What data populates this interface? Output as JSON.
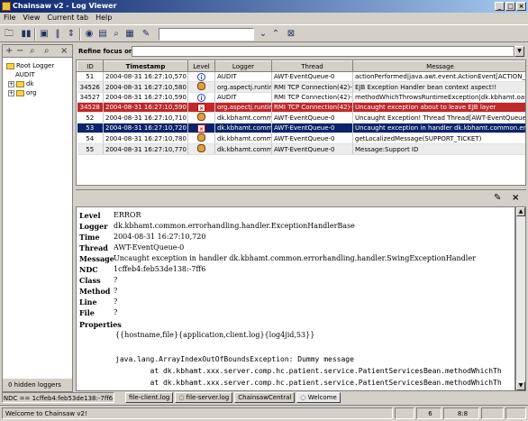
{
  "window": {
    "title": "Chainsaw v2 - Log Viewer"
  },
  "menu": [
    "File",
    "View",
    "Current tab",
    "Help"
  ],
  "left": {
    "tree": [
      {
        "label": "Root Logger"
      },
      {
        "label": "AUDIT"
      },
      {
        "label": "dk"
      },
      {
        "label": "org"
      }
    ],
    "hidden_loggers": "0 hidden loggers"
  },
  "refine": {
    "label": "Refine focus on:"
  },
  "table": {
    "columns": [
      "ID",
      "Timestamp",
      "Level",
      "Logger",
      "Thread",
      "Message"
    ],
    "rows": [
      {
        "id": "51",
        "ts": "2004-08-31 16:27:10,570",
        "level": "info",
        "logger": "AUDIT",
        "thread": "AWT-EventQueue-0",
        "message": "actionPerformed|java.awt.event.ActionEvent[ACTION_PERF",
        "style": ""
      },
      {
        "id": "34526",
        "ts": "2004-08-31 16:27:10,580",
        "level": "warn",
        "logger": "org.aspectj.runtim...",
        "thread": "RMI TCP Connection(42)-10....",
        "message": "EJB Exception Handler bean context aspect!!",
        "style": "alt"
      },
      {
        "id": "34527",
        "ts": "2004-08-31 16:27:10,590",
        "level": "info",
        "logger": "AUDIT",
        "thread": "RMI TCP Connection(42)-10....",
        "message": "methodWhichThrowsRuntimeException|dk.kbhamt.oasman...",
        "style": ""
      },
      {
        "id": "34528",
        "ts": "2004-08-31 16:27:10,590",
        "level": "error",
        "logger": "org.aspectj.runtim...",
        "thread": "RMI TCP Connection(42)-10....",
        "message": "Uncaught exception about to leave EJB layer",
        "style": "err"
      },
      {
        "id": "52",
        "ts": "2004-08-31 16:27:10,710",
        "level": "warn",
        "logger": "dk.kbhamt.commo...",
        "thread": "AWT-EventQueue-0",
        "message": "Uncaught Exception! Thread Thread[AWT-EventQueue-0,6,...",
        "style": ""
      },
      {
        "id": "53",
        "ts": "2004-08-31 16:27:10,720",
        "level": "error",
        "logger": "dk.kbhamt.commo...",
        "thread": "AWT-EventQueue-0",
        "message": "Uncaught exception in handler dk.kbhamt.common.errorhan...",
        "style": "sel"
      },
      {
        "id": "54",
        "ts": "2004-08-31 16:27:10,780",
        "level": "warn",
        "logger": "dk.kbhamt.commo...",
        "thread": "AWT-EventQueue-0",
        "message": "getLocalizedMessage(SUPPORT_TICKET)",
        "style": ""
      },
      {
        "id": "55",
        "ts": "2004-08-31 16:27:10,770",
        "level": "warn",
        "logger": "dk.kbhamt.commo...",
        "thread": "AWT-EventQueue-0",
        "message": "Message:Support ID",
        "style": "alt"
      }
    ]
  },
  "detail": {
    "fields": [
      {
        "k": "Level",
        "v": "ERROR"
      },
      {
        "k": "Logger",
        "v": "dk.kbhamt.common.errorhandling.handler.ExceptionHandlerBase"
      },
      {
        "k": "Time",
        "v": "2004-08-31 16:27:10,720"
      },
      {
        "k": "Thread",
        "v": "AWT-EventQueue-0"
      },
      {
        "k": "Message",
        "v": "Uncaught exception in handler dk.kbhamt.common.errorhandling.handler.SwingExceptionHandler"
      },
      {
        "k": "NDC",
        "v": "1cffeb4:feb53de138:-7ff6"
      },
      {
        "k": "Class",
        "v": "?"
      },
      {
        "k": "Method",
        "v": "?"
      },
      {
        "k": "Line",
        "v": "?"
      },
      {
        "k": "File",
        "v": "?"
      }
    ],
    "properties_label": "Properties",
    "properties_value": "{{hostname,file}{application,client.log}{log4jid,53}}",
    "stack": [
      "java.lang.ArrayIndexOutOfBoundsException: Dummy message",
      "        at dk.kbhamt.xxx.server.comp.hc.patient.service.PatientServicesBean.methodWhichTh",
      "        at dk.kbhamt.xxx.server.comp.hc.patient.service.PatientServicesBean.methodWhichTh"
    ]
  },
  "statusbar": {
    "ndc": "NDC == 1cffeb4:feb53de138:-7ff6",
    "tabs": [
      "file-client.log",
      "file-server.log",
      "ChainsawCentral",
      "Welcome"
    ],
    "message": "Welcome to Chainsaw v2!",
    "count": "6",
    "ratio": "8:8"
  }
}
